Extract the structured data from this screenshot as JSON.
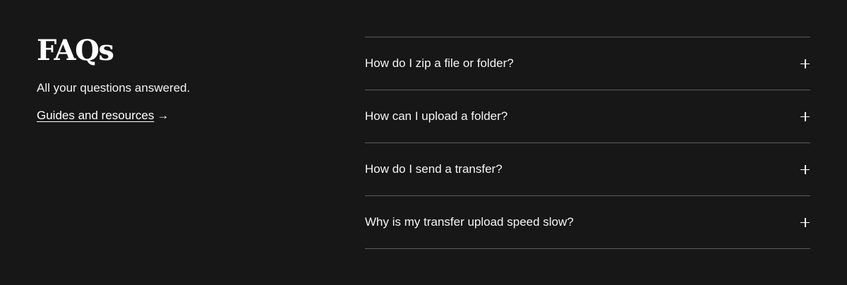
{
  "intro": {
    "title": "FAQs",
    "subtitle": "All your questions answered.",
    "link_label": "Guides and resources",
    "link_arrow": "→"
  },
  "faqs": [
    {
      "question": "How do I zip a file or folder?",
      "icon": "plus-icon"
    },
    {
      "question": "How can I upload a folder?",
      "icon": "plus-icon"
    },
    {
      "question": "How do I send a transfer?",
      "icon": "plus-icon"
    },
    {
      "question": "Why is my transfer upload speed slow?",
      "icon": "plus-icon"
    }
  ],
  "colors": {
    "background": "#171717",
    "text": "#ffffff",
    "divider": "#5c5c5c"
  }
}
